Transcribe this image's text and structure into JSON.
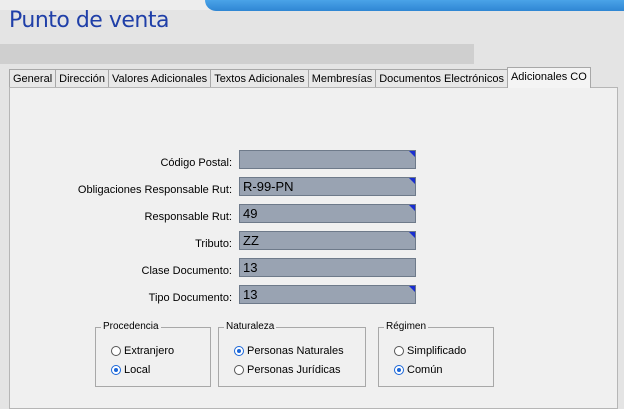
{
  "app_title": "Punto de venta",
  "tabs": [
    {
      "label": "General"
    },
    {
      "label": "Dirección"
    },
    {
      "label": "Valores Adicionales"
    },
    {
      "label": "Textos Adicionales"
    },
    {
      "label": "Membresías"
    },
    {
      "label": "Documentos Electrónicos"
    },
    {
      "label": "Adicionales CO",
      "active": true
    }
  ],
  "fields": [
    {
      "label": "Código Postal:",
      "value": ""
    },
    {
      "label": "Obligaciones Responsable Rut:",
      "value": "R-99-PN"
    },
    {
      "label": "Responsable Rut:",
      "value": "49"
    },
    {
      "label": "Tributo:",
      "value": "ZZ"
    },
    {
      "label": "Clase Documento:",
      "value": "13"
    },
    {
      "label": "Tipo Documento:",
      "value": "13"
    }
  ],
  "groups": {
    "procedencia": {
      "title": "Procedencia",
      "options": [
        "Extranjero",
        "Local"
      ],
      "selected": "Local"
    },
    "naturaleza": {
      "title": "Naturaleza",
      "options": [
        "Personas Naturales",
        "Personas Jurídicas"
      ],
      "selected": "Personas Naturales"
    },
    "regimen": {
      "title": "Régimen",
      "options": [
        "Simplificado",
        "Común"
      ],
      "selected": "Común"
    }
  },
  "colors": {
    "accent": "#1f3fa8",
    "field_bg": "#99a3b2",
    "band": "#2f86d3"
  }
}
